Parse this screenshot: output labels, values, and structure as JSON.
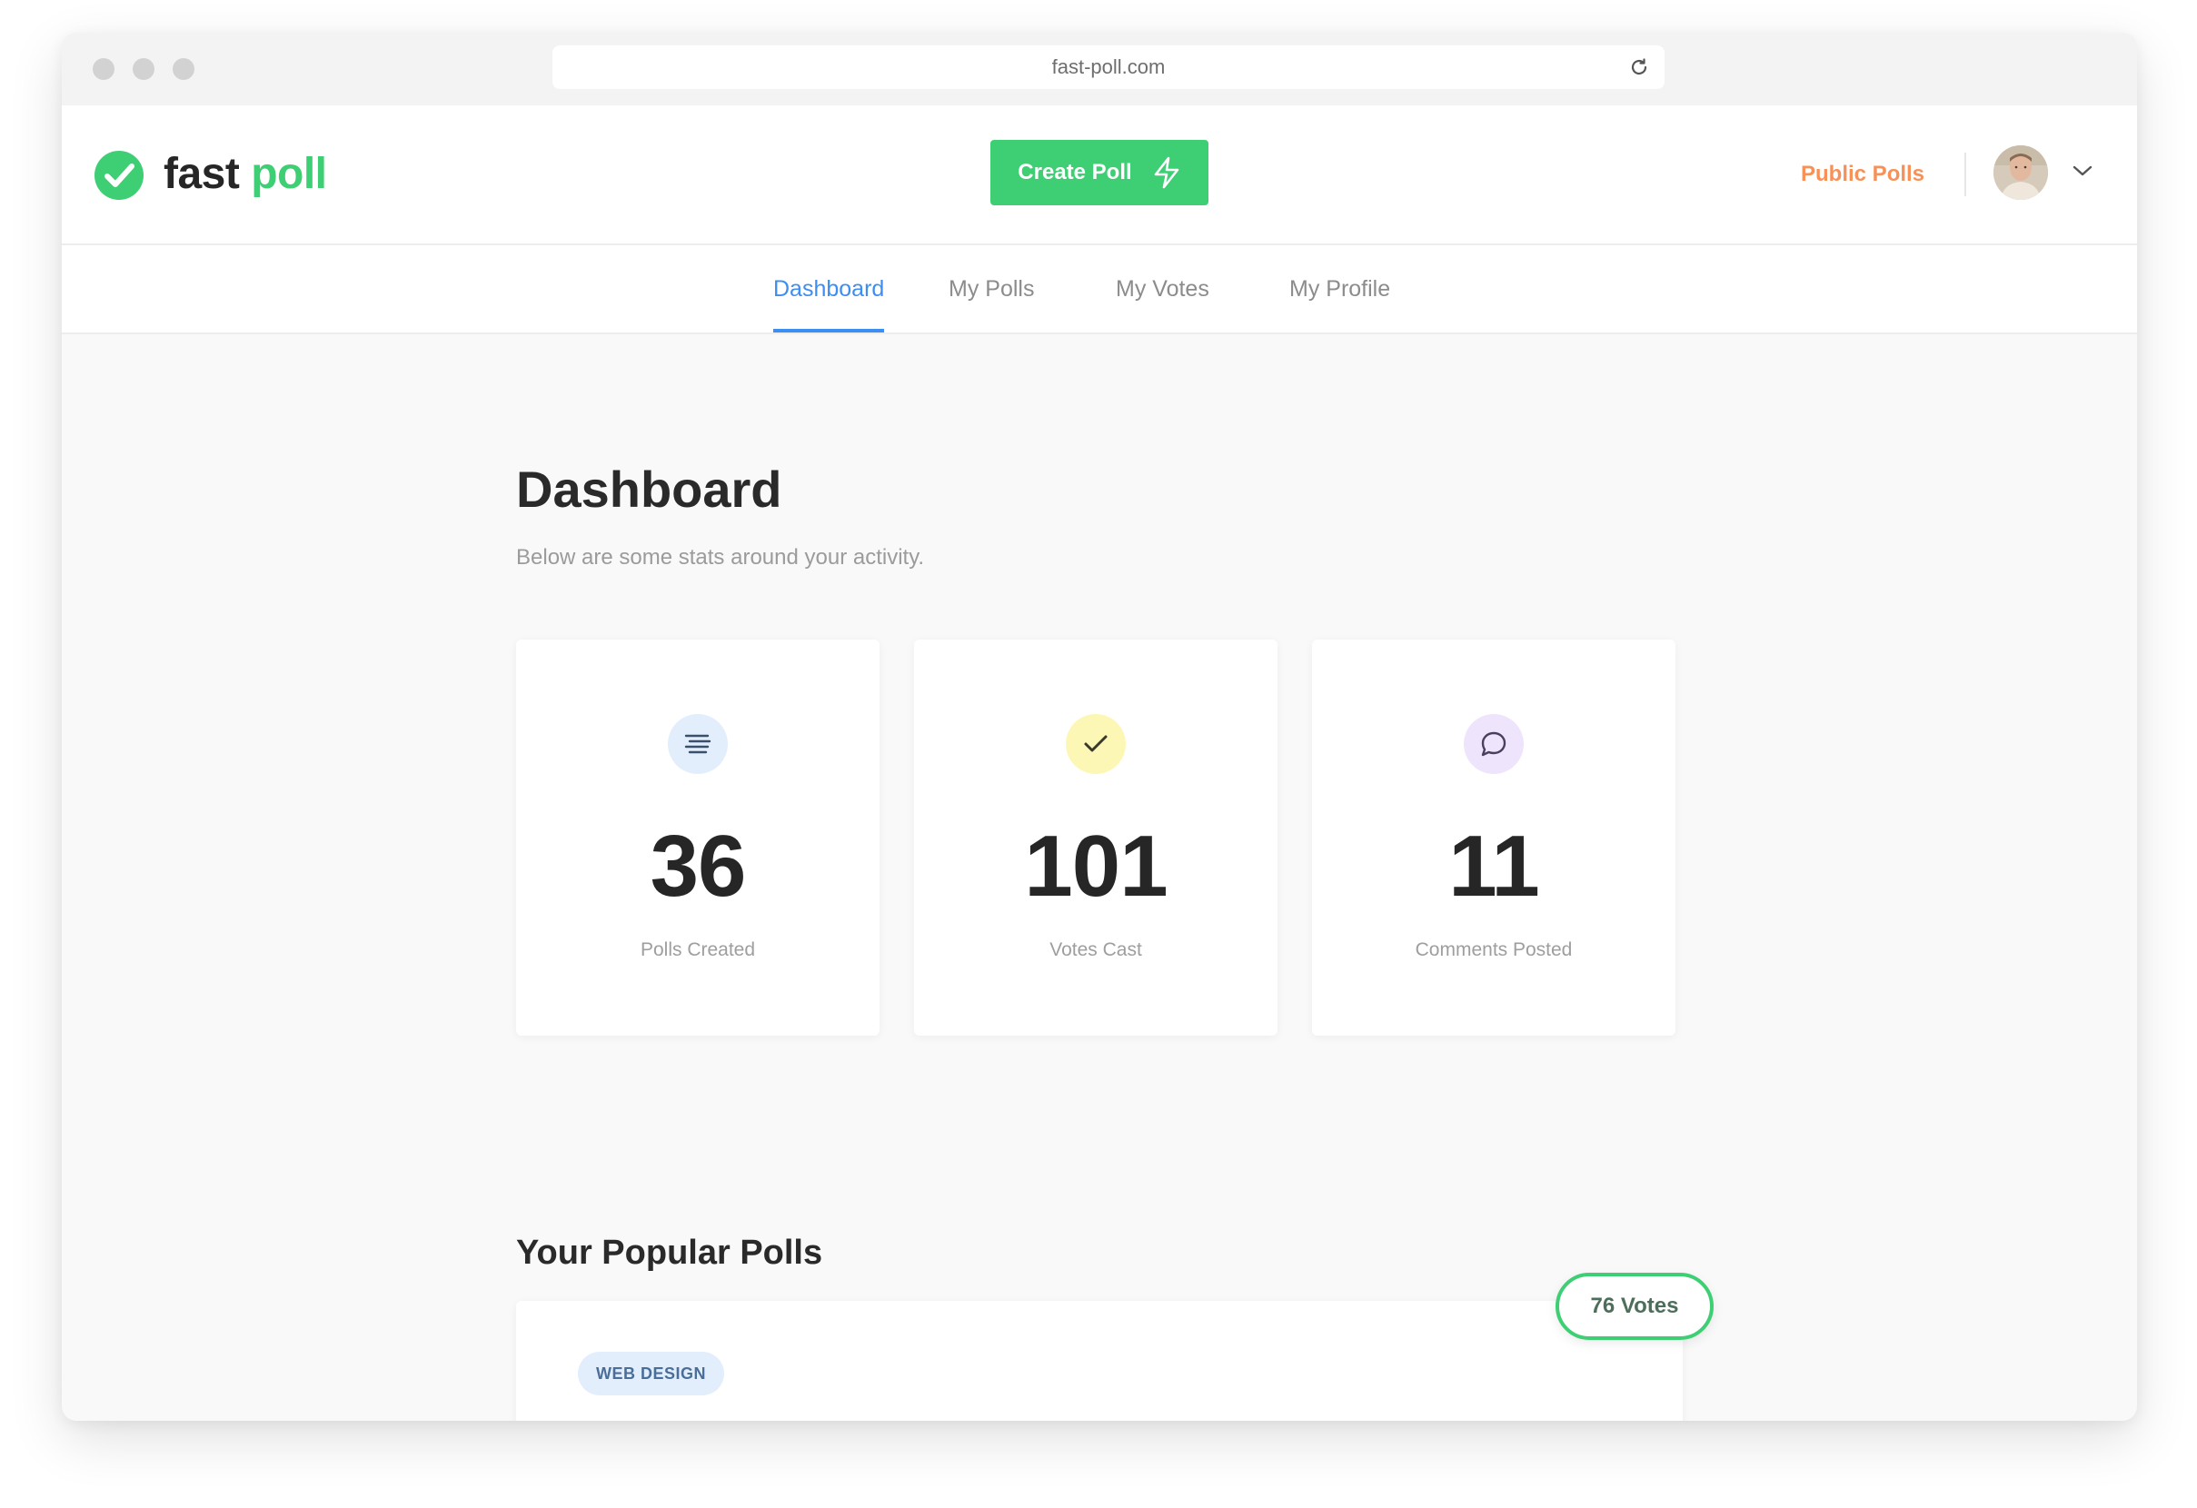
{
  "browser": {
    "url": "fast-poll.com"
  },
  "header": {
    "logo_part1": "fast",
    "logo_part2": "poll",
    "create_poll_label": "Create Poll",
    "public_polls_label": "Public Polls"
  },
  "nav": {
    "tabs": [
      {
        "label": "Dashboard",
        "active": true
      },
      {
        "label": "My Polls",
        "active": false
      },
      {
        "label": "My Votes",
        "active": false
      },
      {
        "label": "My Profile",
        "active": false
      }
    ]
  },
  "main": {
    "title": "Dashboard",
    "subtitle": "Below are some stats around your activity.",
    "stats": [
      {
        "icon": "list-icon",
        "value": "36",
        "label": "Polls Created",
        "icon_bg": "#e3eefc",
        "icon_color": "#3a4f6b"
      },
      {
        "icon": "check-icon",
        "value": "101",
        "label": "Votes Cast",
        "icon_bg": "#fdf7b6",
        "icon_color": "#3a3a2a"
      },
      {
        "icon": "comment-icon",
        "value": "11",
        "label": "Comments Posted",
        "icon_bg": "#eee4fc",
        "icon_color": "#4a3f5e"
      }
    ]
  },
  "popular": {
    "title": "Your Popular Polls",
    "polls": [
      {
        "tag": "WEB DESIGN",
        "votes": "76 Votes"
      }
    ]
  },
  "colors": {
    "brand_green": "#3ecf74",
    "accent_orange": "#f79157",
    "active_blue": "#3d8ef0"
  }
}
